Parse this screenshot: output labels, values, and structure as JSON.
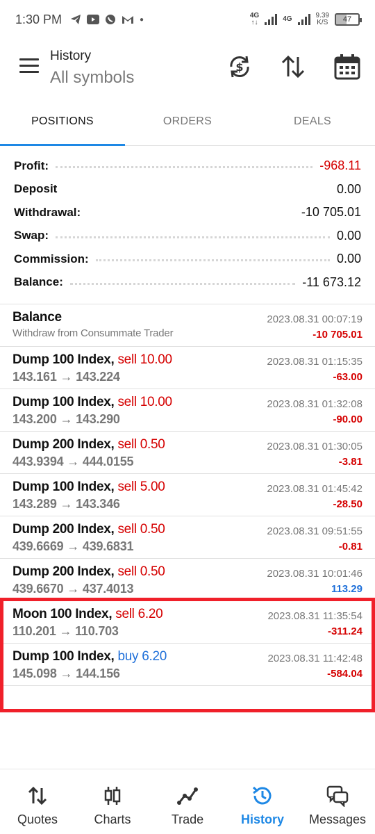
{
  "status_bar": {
    "time": "1:30 PM",
    "net_speed": "9.39",
    "net_speed_unit": "K/S",
    "battery": "47",
    "network_1": "4G",
    "network_2": "4G"
  },
  "header": {
    "title": "History",
    "subtitle": "All symbols"
  },
  "tabs": [
    {
      "label": "POSITIONS",
      "active": true
    },
    {
      "label": "ORDERS",
      "active": false
    },
    {
      "label": "DEALS",
      "active": false
    }
  ],
  "summary": [
    {
      "label": "Profit:",
      "value": "-968.11",
      "negative": true
    },
    {
      "label": "Deposit",
      "value": "0.00",
      "negative": false
    },
    {
      "label": "Withdrawal:",
      "value": "-10 705.01",
      "negative": false
    },
    {
      "label": "Swap:",
      "value": "0.00",
      "negative": false
    },
    {
      "label": "Commission:",
      "value": "0.00",
      "negative": false
    },
    {
      "label": "Balance:",
      "value": "-11 673.12",
      "negative": false
    }
  ],
  "deals": [
    {
      "symbol": "Balance",
      "side": "",
      "prices": "Withdraw from Consummate Trader",
      "date": "2023.08.31 00:07:19",
      "profit": "-10 705.01",
      "profit_sign": "neg"
    },
    {
      "symbol": "Dump 100 Index,",
      "side": "sell 10.00",
      "prices": "143.161 → 143.224",
      "date": "2023.08.31 01:15:35",
      "profit": "-63.00",
      "profit_sign": "neg"
    },
    {
      "symbol": "Dump 100 Index,",
      "side": "sell 10.00",
      "prices": "143.200 → 143.290",
      "date": "2023.08.31 01:32:08",
      "profit": "-90.00",
      "profit_sign": "neg"
    },
    {
      "symbol": "Dump 200 Index,",
      "side": "sell 0.50",
      "prices": "443.9394 → 444.0155",
      "date": "2023.08.31 01:30:05",
      "profit": "-3.81",
      "profit_sign": "neg"
    },
    {
      "symbol": "Dump 100 Index,",
      "side": "sell 5.00",
      "prices": "143.289 → 143.346",
      "date": "2023.08.31 01:45:42",
      "profit": "-28.50",
      "profit_sign": "neg"
    },
    {
      "symbol": "Dump 200 Index,",
      "side": "sell 0.50",
      "prices": "439.6669 → 439.6831",
      "date": "2023.08.31 09:51:55",
      "profit": "-0.81",
      "profit_sign": "neg"
    },
    {
      "symbol": "Dump 200 Index,",
      "side": "sell 0.50",
      "prices": "439.6670 → 437.4013",
      "date": "2023.08.31 10:01:46",
      "profit": "113.29",
      "profit_sign": "pos"
    },
    {
      "symbol": "Moon 100 Index,",
      "side": "sell 6.20",
      "prices": "110.201 → 110.703",
      "date": "2023.08.31 11:35:54",
      "profit": "-311.24",
      "profit_sign": "neg"
    },
    {
      "symbol": "Dump 100 Index,",
      "side": "buy 6.20",
      "prices": "145.098 → 144.156",
      "date": "2023.08.31 11:42:48",
      "profit": "-584.04",
      "profit_sign": "neg"
    }
  ],
  "bottom_nav": [
    {
      "label": "Quotes",
      "icon": "quotes-arrows-icon",
      "active": false
    },
    {
      "label": "Charts",
      "icon": "candlestick-icon",
      "active": false
    },
    {
      "label": "Trade",
      "icon": "trade-line-icon",
      "active": false
    },
    {
      "label": "History",
      "icon": "history-clock-icon",
      "active": true
    },
    {
      "label": "Messages",
      "icon": "messages-chat-icon",
      "active": false
    }
  ],
  "colors": {
    "accent": "#1e88e5",
    "negative": "#d50000",
    "positive": "#1e6fd9",
    "highlight_box": "#f0202a"
  }
}
